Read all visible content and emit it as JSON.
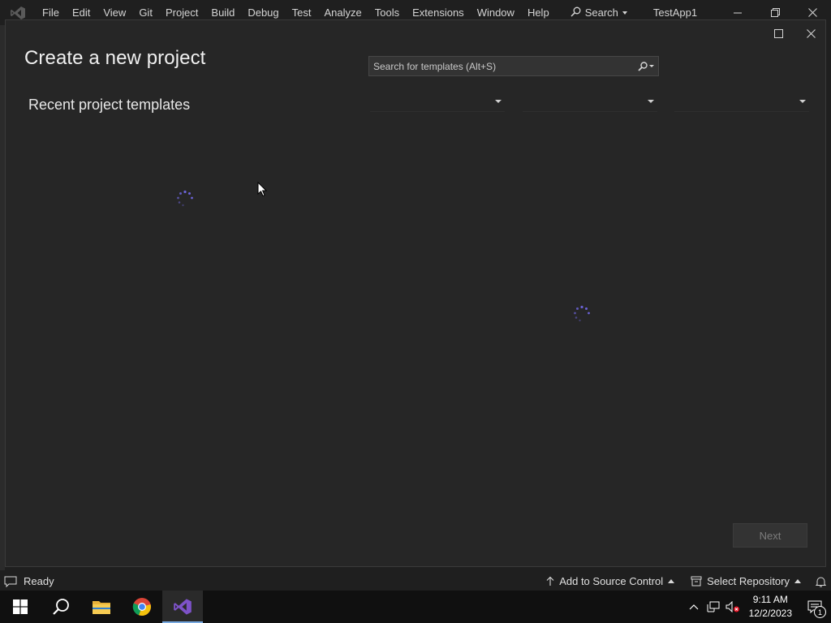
{
  "menubar": {
    "items": [
      "File",
      "Edit",
      "View",
      "Git",
      "Project",
      "Build",
      "Debug",
      "Test",
      "Analyze",
      "Tools",
      "Extensions",
      "Window",
      "Help"
    ],
    "search_label": "Search",
    "app_title": "TestApp1"
  },
  "dialog": {
    "title": "Create a new project",
    "recent_title": "Recent project templates",
    "search": {
      "placeholder": "Search for templates (Alt+S)",
      "value": ""
    },
    "filters": [
      "",
      "",
      ""
    ],
    "next_label": "Next"
  },
  "statusbar": {
    "ready_label": "Ready",
    "add_source_control_label": "Add to Source Control",
    "select_repository_label": "Select Repository"
  },
  "taskbar": {
    "apps": [
      "search-icon",
      "file-explorer-icon",
      "chrome-icon",
      "visual-studio-icon"
    ],
    "time": "9:11 AM",
    "date": "12/2/2023",
    "notification_count": "1"
  },
  "colors": {
    "accent": "#76a8e0",
    "vs_purple": "#7d52c8",
    "spinner": "#6b63d6",
    "background": "#1f1f1f",
    "dialog_bg": "#262626"
  }
}
